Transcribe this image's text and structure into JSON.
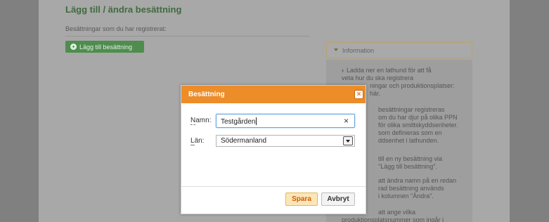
{
  "page": {
    "title": "Lägg till / ändra besättning",
    "subtitle": "Besättningar som du har registrerat:",
    "add_button_label": "Lägg till besättning"
  },
  "info": {
    "title": "Information",
    "paragraphs": [
      "Ladda ner en lathund för att få veta hur du ska registrera besättningar och produktionsplatser: Lathund här.",
      "Olika besättningar registreras om du har djur på olika PPN eller för olika smittskyddsenheter. Läs om hur dessa definieras som en smittskyddsenhet i lathunden.",
      "Lägg till en ny besättning via knappen \"Lägg till besättning\".",
      "Ändra namn på en redan registrerad besättning används knappen i kolumnen \"Ändra\".",
      "Glöm inte att ange vilka produktionsplatsnummer som ingår i"
    ],
    "paragraph_fragments": [
      [
        "Ladda ner en lathund för att få",
        "veta hur du ska registrera",
        "ningar och produktionsplatser:",
        "här."
      ],
      [
        "besättningar registreras",
        "om du har djur på olika PPN",
        "för olika smittskyddsenheter.",
        "som definieras som en",
        "ddsenhet i lathunden."
      ],
      [
        "till en ny besättning via",
        "\"Lägg till besättning\"."
      ],
      [
        "att ändra namn på en redan",
        "rad besättning används",
        "i kolumnen \"Ändra\"."
      ],
      [
        "att ange vilka",
        "produktionsplatsnummer som ingår i"
      ]
    ]
  },
  "dialog": {
    "title": "Besättning",
    "close_symbol": "×",
    "name_label_key": "N",
    "name_label_rest": "amn:",
    "name_value": "Testgården",
    "clear_symbol": "×",
    "county_label_key": "L",
    "county_label_rest": "än:",
    "county_value": "Södermanland",
    "save_label": "Spara",
    "cancel_label": "Avbryt"
  },
  "colors": {
    "dialog_header": "#ec8d2a",
    "add_button": "#4e8d4e",
    "title_green": "#3f6b3f"
  }
}
